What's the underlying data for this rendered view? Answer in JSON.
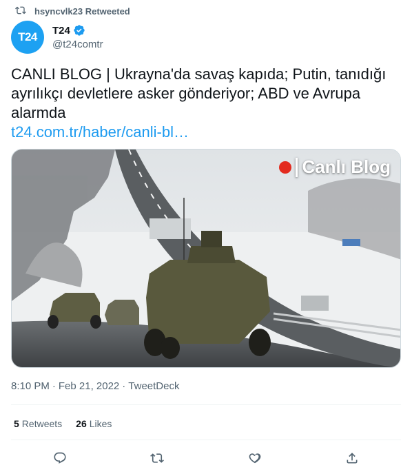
{
  "retweet": {
    "text": "hsyncvlk23 Retweeted",
    "icon": "retweet-icon"
  },
  "author": {
    "avatar_text": "T24",
    "avatar_color": "#1da1f2",
    "display_name": "T24",
    "verified": true,
    "handle": "@t24comtr"
  },
  "tweet": {
    "text": "CANLI BLOG | Ukrayna'da savaş kapıda; Putin, tanıdığı ayrılıkçı devletlere asker gönderiyor; ABD ve Avrupa alarmda",
    "link": "t24.com.tr/haber/canli-bl…"
  },
  "media": {
    "badge_text": "Canlı Blog",
    "badge_dot_color": "#e32b1f"
  },
  "meta": {
    "time": "8:10 PM",
    "separator": "·",
    "date": "Feb 21, 2022",
    "source": "TweetDeck"
  },
  "stats": {
    "retweets_count": "5",
    "retweets_label": "Retweets",
    "likes_count": "26",
    "likes_label": "Likes"
  },
  "actions": [
    "reply-icon",
    "retweet-icon",
    "like-icon",
    "share-icon"
  ],
  "colors": {
    "link": "#1d9bf0",
    "secondary_text": "#536471"
  }
}
